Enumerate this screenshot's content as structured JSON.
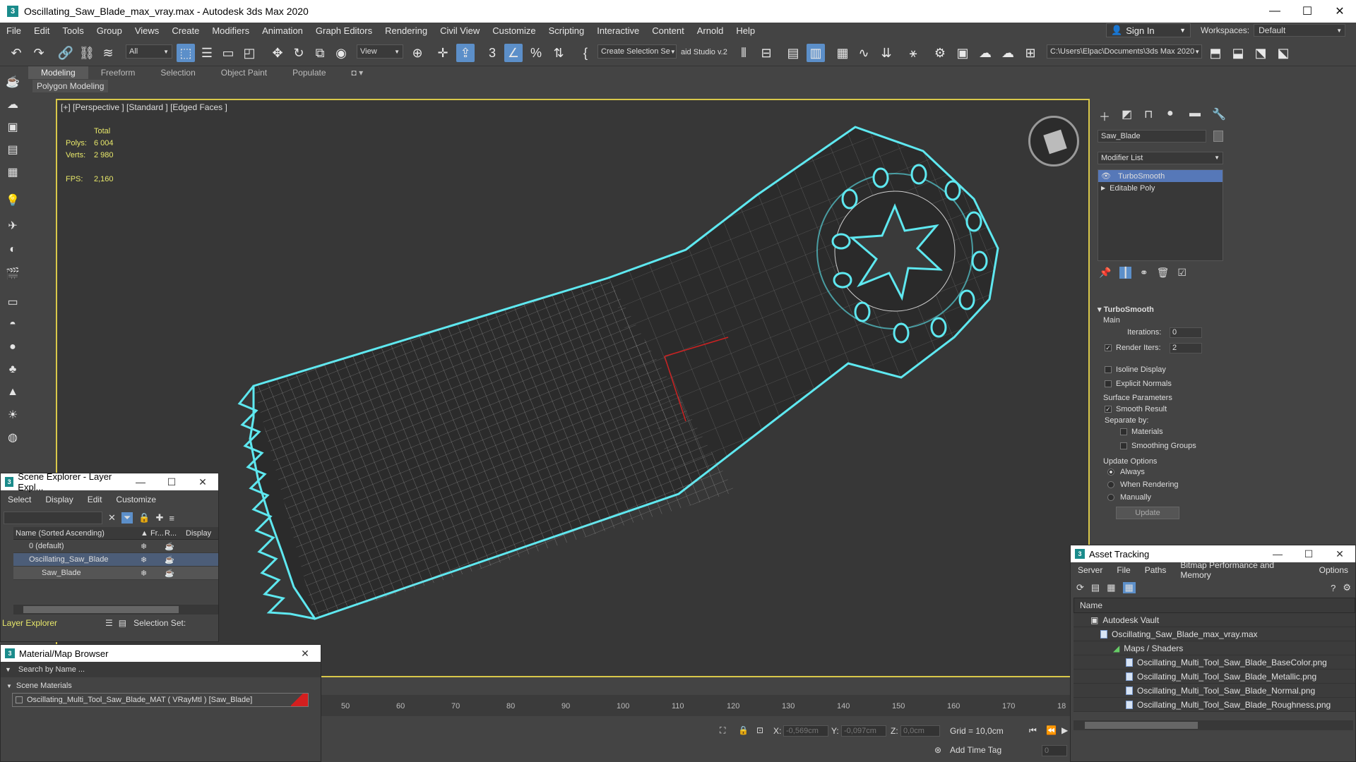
{
  "window": {
    "title": "Oscillating_Saw_Blade_max_vray.max - Autodesk 3ds Max 2020",
    "min": "—",
    "max": "☐",
    "close": "✕"
  },
  "menu": [
    "File",
    "Edit",
    "Tools",
    "Group",
    "Views",
    "Create",
    "Modifiers",
    "Animation",
    "Graph Editors",
    "Rendering",
    "Civil View",
    "Customize",
    "Scripting",
    "Interactive",
    "Content",
    "Arnold",
    "Help"
  ],
  "account": {
    "signin": "Sign In",
    "workspaces_label": "Workspaces:",
    "workspace": "Default"
  },
  "toolbar": {
    "filter": "All",
    "refcoord": "View",
    "selset": "Create Selection Se",
    "studio": "aid Studio v.2",
    "path": "C:\\Users\\Elpac\\Documents\\3ds Max 2020"
  },
  "ribbon": {
    "tabs": [
      "Modeling",
      "Freeform",
      "Selection",
      "Object Paint",
      "Populate"
    ],
    "sub": "Polygon Modeling"
  },
  "viewport": {
    "label": "[+] [Perspective ] [Standard ] [Edged Faces ]",
    "stats": {
      "total_label": "Total",
      "polys_label": "Polys:",
      "polys": "6 004",
      "verts_label": "Verts:",
      "verts": "2 980",
      "fps_label": "FPS:",
      "fps": "2,160"
    },
    "accent": "#5ee8f0"
  },
  "command_panel": {
    "object_name": "Saw_Blade",
    "modifier_list": "Modifier List",
    "stack": [
      "TurboSmooth",
      "Editable Poly"
    ],
    "rollout": "TurboSmooth",
    "main_label": "Main",
    "iterations_label": "Iterations:",
    "iterations": "0",
    "render_iters_label": "Render Iters:",
    "render_iters": "2",
    "isoline": "Isoline Display",
    "explicit": "Explicit Normals",
    "surface_label": "Surface Parameters",
    "smooth_result": "Smooth Result",
    "separate_by": "Separate by:",
    "materials": "Materials",
    "smoothing_groups": "Smoothing Groups",
    "update_options": "Update Options",
    "always": "Always",
    "when_rendering": "When Rendering",
    "manually": "Manually",
    "update": "Update"
  },
  "scene_explorer": {
    "title": "Scene Explorer - Layer Expl...",
    "menu": [
      "Select",
      "Display",
      "Edit",
      "Customize"
    ],
    "cols": [
      "Name (Sorted Ascending)",
      "▲ Fr...",
      "R...",
      "Display"
    ],
    "rows": [
      {
        "name": "0 (default)"
      },
      {
        "name": "Oscillating_Saw_Blade"
      },
      {
        "name": "Saw_Blade"
      }
    ],
    "footer_label": "Layer Explorer",
    "selection_set": "Selection Set:"
  },
  "material_browser": {
    "title": "Material/Map Browser",
    "search": "Search by Name ...",
    "group": "Scene Materials",
    "item": "Oscillating_Multi_Tool_Saw_Blade_MAT  ( VRayMtl )  [Saw_Blade]"
  },
  "timeline": {
    "ticks": [
      "50",
      "60",
      "70",
      "80",
      "90",
      "100",
      "110",
      "120",
      "130",
      "140",
      "150",
      "160",
      "170",
      "18"
    ]
  },
  "status": {
    "x_label": "X:",
    "x": "-0,569cm",
    "y_label": "Y:",
    "y": "-0,097cm",
    "z_label": "Z:",
    "z": "0,0cm",
    "grid": "Grid = 10,0cm",
    "add_time_tag": "Add Time Tag",
    "frame": "0"
  },
  "asset_tracking": {
    "title": "Asset Tracking",
    "menu": [
      "Server",
      "File",
      "Paths",
      "Bitmap Performance and Memory",
      "Options"
    ],
    "col": "Name",
    "rows": [
      "Autodesk Vault",
      "Oscillating_Saw_Blade_max_vray.max",
      "Maps / Shaders",
      "Oscillating_Multi_Tool_Saw_Blade_BaseColor.png",
      "Oscillating_Multi_Tool_Saw_Blade_Metallic.png",
      "Oscillating_Multi_Tool_Saw_Blade_Normal.png",
      "Oscillating_Multi_Tool_Saw_Blade_Roughness.png"
    ]
  }
}
